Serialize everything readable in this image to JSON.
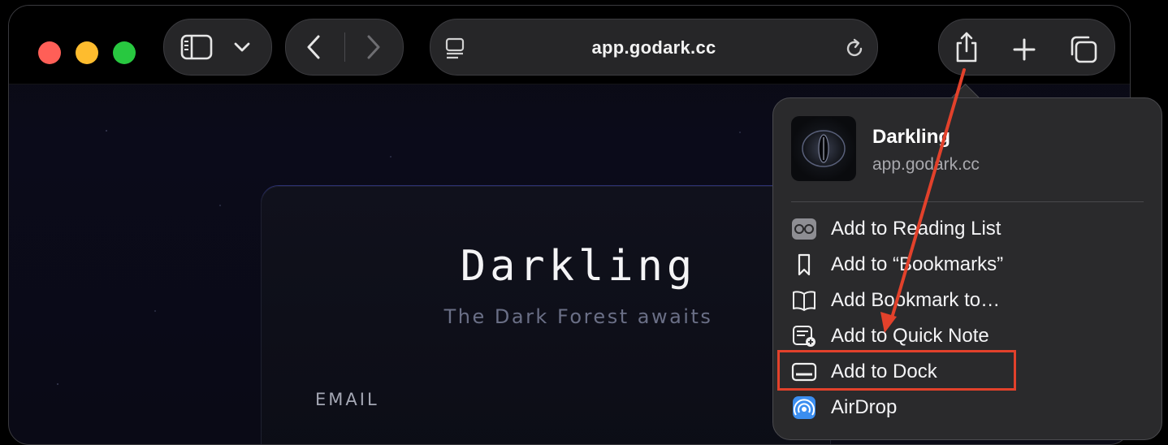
{
  "toolbar": {
    "url": "app.godark.cc"
  },
  "page": {
    "title": "Darkling",
    "subtitle": "The Dark Forest awaits",
    "email_label": "EMAIL"
  },
  "share_menu": {
    "site_name": "Darkling",
    "site_url": "app.godark.cc",
    "items": [
      {
        "label": "Add to Reading List",
        "icon": "reading-list-icon"
      },
      {
        "label": "Add to “Bookmarks”",
        "icon": "bookmark-icon"
      },
      {
        "label": "Add Bookmark to…",
        "icon": "book-icon"
      },
      {
        "label": "Add to Quick Note",
        "icon": "quick-note-icon"
      },
      {
        "label": "Add to Dock",
        "icon": "dock-icon"
      },
      {
        "label": "AirDrop",
        "icon": "airdrop-icon"
      }
    ]
  },
  "annotation": {
    "highlighted_item": "Add to Dock",
    "color": "#e2412b"
  },
  "colors": {
    "close": "#ff5f57",
    "minimize": "#febc2e",
    "zoom": "#28c840"
  }
}
